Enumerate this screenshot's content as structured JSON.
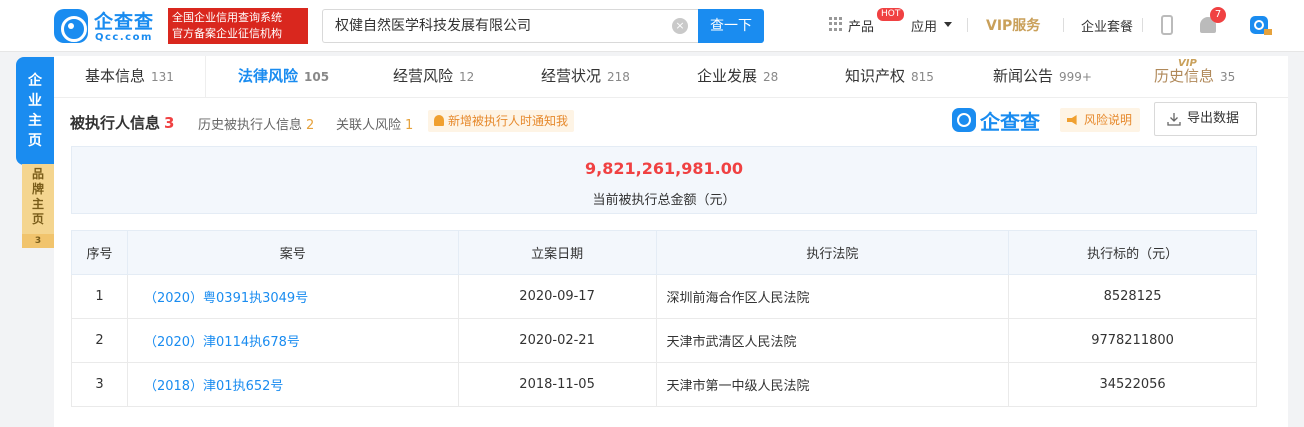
{
  "header": {
    "logo_text": "企查查",
    "logo_sub": "Qcc.com",
    "badge_line1": "全国企业信用查询系统",
    "badge_line2": "官方备案企业征信机构",
    "search_value": "权健自然医学科技发展有限公司",
    "search_button": "查一下",
    "nav_product": "产品",
    "hot_tag": "HOT",
    "nav_app": "应用",
    "nav_vip": "VIP服务",
    "nav_suite": "企业套餐",
    "notification_count": "7"
  },
  "sidebar": {
    "main_label": [
      "企",
      "业",
      "主",
      "页"
    ],
    "brand_label": [
      "品",
      "牌",
      "主",
      "页"
    ],
    "brand_count": "3"
  },
  "tabs": [
    {
      "label": "基本信息",
      "count": "131"
    },
    {
      "label": "法律风险",
      "count": "105"
    },
    {
      "label": "经营风险",
      "count": "12"
    },
    {
      "label": "经营状况",
      "count": "218"
    },
    {
      "label": "企业发展",
      "count": "28"
    },
    {
      "label": "知识产权",
      "count": "815"
    },
    {
      "label": "新闻公告",
      "count": "999+"
    },
    {
      "label": "历史信息",
      "count": "35"
    }
  ],
  "vip_tag": "VIP",
  "section": {
    "title": "被执行人信息",
    "title_count": "3",
    "history_label": "历史被执行人信息",
    "history_count": "2",
    "related_label": "关联人风险",
    "related_count": "1",
    "notify_label": "新增被执行人时通知我",
    "brand_logo_text": "企查查",
    "risk_label": "风险说明",
    "export_label": "导出数据"
  },
  "summary": {
    "amount": "9,821,261,981.00",
    "label": "当前被执行总金额（元）"
  },
  "table": {
    "headers": [
      "序号",
      "案号",
      "立案日期",
      "执行法院",
      "执行标的（元）"
    ],
    "rows": [
      [
        "1",
        "（2020）粤0391执3049号",
        "2020-09-17",
        "深圳前海合作区人民法院",
        "8528125"
      ],
      [
        "2",
        "（2020）津0114执678号",
        "2020-02-21",
        "天津市武清区人民法院",
        "9778211800"
      ],
      [
        "3",
        "（2018）津01执652号",
        "2018-11-05",
        "天津市第一中级人民法院",
        "34522056"
      ]
    ]
  },
  "colors": {
    "brand_blue": "#1a8cf0",
    "accent_red": "#f04142",
    "warning_orange": "#e6892c",
    "vip_gold": "#c9a05a"
  }
}
